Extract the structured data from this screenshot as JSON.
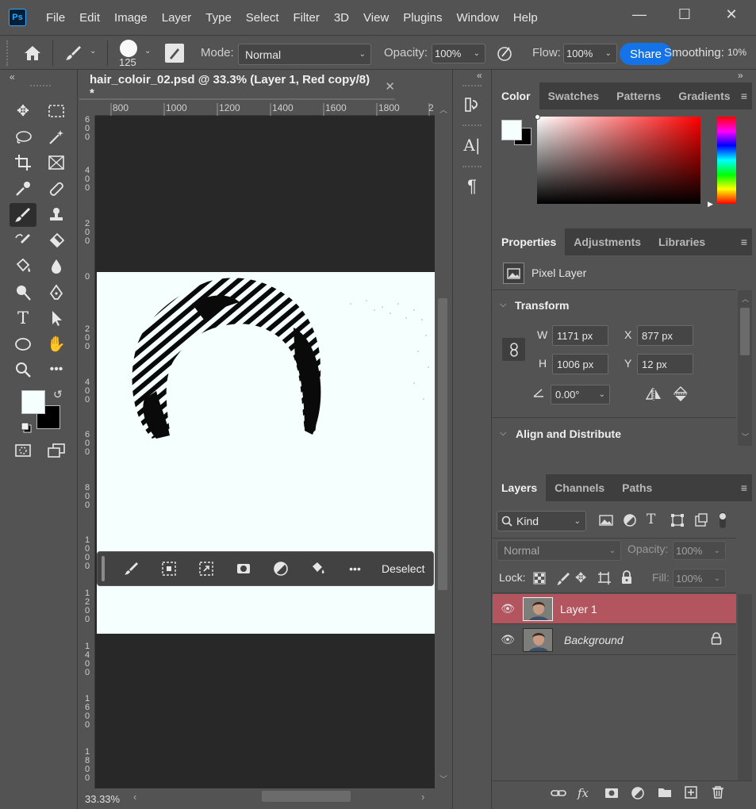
{
  "app": {
    "logo": "Ps",
    "menus": [
      "File",
      "Edit",
      "Image",
      "Layer",
      "Type",
      "Select",
      "Filter",
      "3D",
      "View",
      "Plugins",
      "Window",
      "Help"
    ]
  },
  "window_controls": {
    "minimize": "—",
    "maximize": "☐",
    "close": "✕"
  },
  "options": {
    "brush_size": "125",
    "mode_label": "Mode:",
    "mode_value": "Normal",
    "opacity_label": "Opacity:",
    "opacity_value": "100%",
    "flow_label": "Flow:",
    "flow_value": "100%",
    "share_label": "Share",
    "smoothing_label": "Smoothing:",
    "smoothing_value": "10%"
  },
  "document": {
    "tab_title": "hair_coloir_02.psd @ 33.3% (Layer 1, Red copy/8) *",
    "ruler_top": [
      "800",
      "1000",
      "1200",
      "1400",
      "1600",
      "1800",
      "2"
    ],
    "ruler_left": [
      "6\n0\n0",
      "4\n0\n0",
      "2\n0\n0",
      "0",
      "2\n0\n0",
      "4\n0\n0",
      "6\n0\n0",
      "8\n0\n0",
      "1\n0\n0\n0",
      "1\n2\n0\n0",
      "1\n4\n0\n0",
      "1\n6\n0\n0",
      "1\n8\n0\n0"
    ],
    "zoom": "33.33%"
  },
  "context_bar": {
    "deselect_label": "Deselect"
  },
  "color_panel": {
    "tabs": [
      "Color",
      "Swatches",
      "Patterns",
      "Gradients"
    ],
    "foreground": "#f4fffe",
    "background": "#000000"
  },
  "properties_panel": {
    "tabs": [
      "Properties",
      "Adjustments",
      "Libraries"
    ],
    "layer_type": "Pixel Layer",
    "transform_label": "Transform",
    "w_label": "W",
    "w_value": "1171 px",
    "h_label": "H",
    "h_value": "1006 px",
    "x_label": "X",
    "x_value": "877 px",
    "y_label": "Y",
    "y_value": "12 px",
    "angle_value": "0.00°",
    "align_label": "Align and Distribute"
  },
  "layers_panel": {
    "tabs": [
      "Layers",
      "Channels",
      "Paths"
    ],
    "kind_label": "Kind",
    "blend_mode": "Normal",
    "opacity_label": "Opacity:",
    "opacity_value": "100%",
    "lock_label": "Lock:",
    "fill_label": "Fill:",
    "fill_value": "100%",
    "layers": [
      {
        "name": "Layer 1",
        "selected": true
      },
      {
        "name": "Background",
        "selected": false
      }
    ],
    "selected_color": "#b2555e"
  }
}
